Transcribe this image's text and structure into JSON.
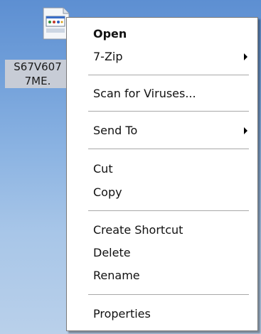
{
  "desktop": {
    "file_label_line1": "S67V607",
    "file_label_line2": "7ME."
  },
  "icons": {
    "file": "document-icon",
    "submenu": "submenu-arrow-icon"
  },
  "context_menu": {
    "open": "Open",
    "seven_zip": "7-Zip",
    "scan": "Scan for Viruses...",
    "send_to": "Send To",
    "cut": "Cut",
    "copy": "Copy",
    "create_shortcut": "Create Shortcut",
    "delete": "Delete",
    "rename": "Rename",
    "properties": "Properties"
  }
}
